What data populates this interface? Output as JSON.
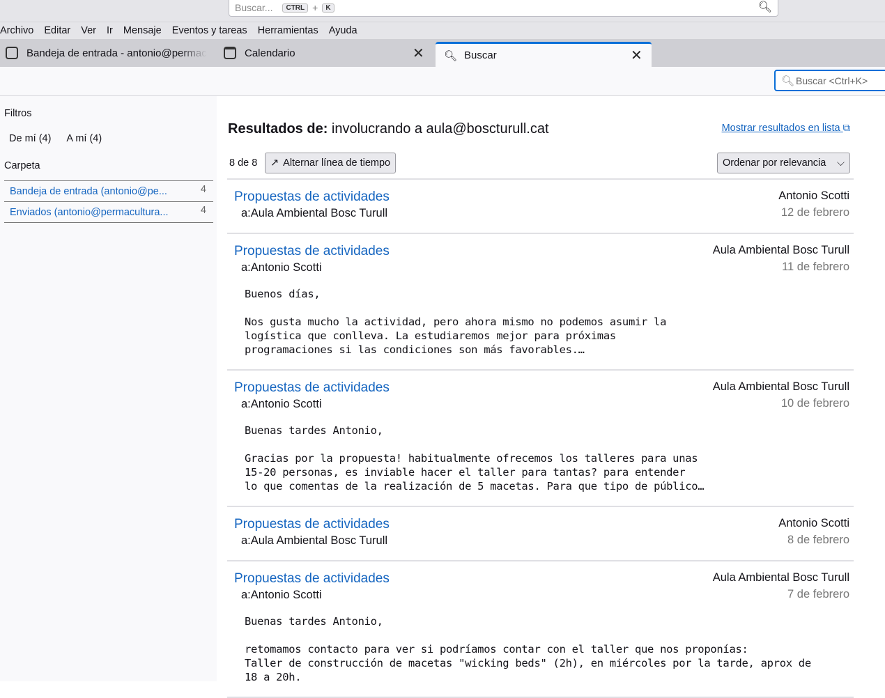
{
  "global_search": {
    "placeholder": "Buscar...",
    "key1": "CTRL",
    "plus": "+",
    "key2": "K"
  },
  "menu": [
    "Archivo",
    "Editar",
    "Ver",
    "Ir",
    "Mensaje",
    "Eventos y tareas",
    "Herramientas",
    "Ayuda"
  ],
  "tabs": [
    {
      "label": "Bandeja de entrada - antonio@permac"
    },
    {
      "label": "Calendario"
    },
    {
      "label": "Buscar"
    }
  ],
  "toolbar": {
    "search_placeholder": "Buscar <Ctrl+K>"
  },
  "sidebar": {
    "filters_title": "Filtros",
    "filters": [
      "De mí  (4)",
      "A mí  (4)"
    ],
    "folder_title": "Carpeta",
    "folders": [
      {
        "name": "Bandeja de entrada (antonio@pe...",
        "count": "4"
      },
      {
        "name": "Enviados (antonio@permacultura...",
        "count": "4"
      }
    ]
  },
  "main": {
    "title_bold": "Resultados de:",
    "title_query": " involucrando a aula@boscturull.cat",
    "show_list": "Mostrar resultados en lista",
    "count": "8 de 8",
    "timeline_button": "Alternar línea de tiempo",
    "sort": "Ordenar por relevancia"
  },
  "results": [
    {
      "subject": "Propuestas de actividades",
      "to": "a:Aula Ambiental Bosc Turull",
      "from": "Antonio Scotti",
      "date": "12 de febrero",
      "body": ""
    },
    {
      "subject": "Propuestas de actividades",
      "to": "a:Antonio Scotti",
      "from": "Aula Ambiental Bosc Turull",
      "date": "11 de febrero",
      "body": "Buenos días,\n\nNos gusta mucho la actividad, pero ahora mismo no podemos asumir la\nlogística que conlleva. La estudiaremos mejor para próximas\nprogramaciones si las condiciones son más favorables.…"
    },
    {
      "subject": "Propuestas de actividades",
      "to": "a:Antonio Scotti",
      "from": "Aula Ambiental Bosc Turull",
      "date": "10 de febrero",
      "body": "Buenas tardes Antonio,\n\nGracias por la propuesta! habitualmente ofrecemos los talleres para unas\n15-20 personas, es inviable hacer el taller para tantas? para entender\nlo que comentas de la realización de 5 macetas. Para que tipo de público…"
    },
    {
      "subject": "Propuestas de actividades",
      "to": "a:Aula Ambiental Bosc Turull",
      "from": "Antonio Scotti",
      "date": "8 de febrero",
      "body": ""
    },
    {
      "subject": "Propuestas de actividades",
      "to": "a:Antonio Scotti",
      "from": "Aula Ambiental Bosc Turull",
      "date": "7 de febrero",
      "body": "Buenas tardes Antonio,\n\nretomamos contacto para ver si podríamos contar con el taller que nos proponías:\nTaller de construcción de macetas \"wicking beds\" (2h), en miércoles por la tarde, aprox de\n18 a 20h."
    }
  ]
}
